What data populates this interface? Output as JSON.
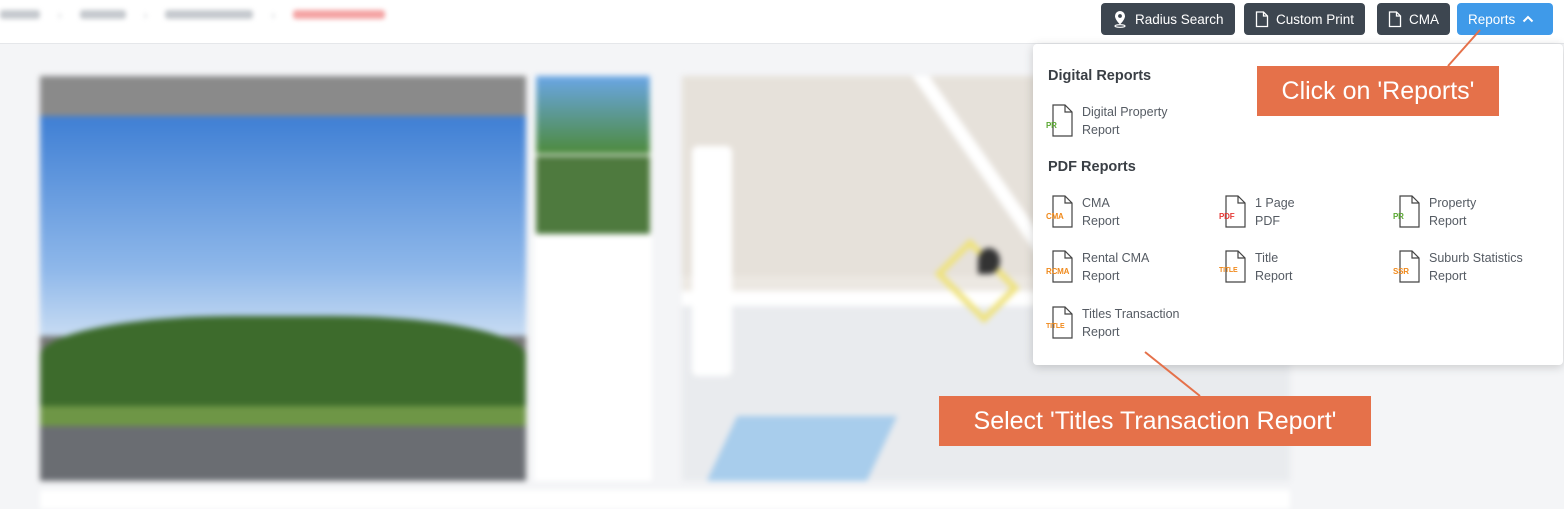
{
  "breadcrumbs": [
    "",
    "",
    "",
    ""
  ],
  "toolbar": {
    "radius_search": "Radius Search",
    "custom_print": "Custom Print",
    "cma": "CMA",
    "reports": "Reports"
  },
  "dropdown": {
    "digital_heading": "Digital Reports",
    "pdf_heading": "PDF Reports",
    "digital_items": [
      {
        "tag": "PR",
        "line1": "Digital Property",
        "line2": "Report",
        "color": "#5aa832"
      }
    ],
    "pdf_items": [
      {
        "tag": "CMA",
        "line1": "CMA",
        "line2": "Report",
        "color": "#f08a1c"
      },
      {
        "tag": "PDF",
        "line1": "1 Page",
        "line2": "PDF",
        "color": "#e53935"
      },
      {
        "tag": "PR",
        "line1": "Property",
        "line2": "Report",
        "color": "#5aa832"
      },
      {
        "tag": "RCMA",
        "line1": "Rental CMA",
        "line2": "Report",
        "color": "#f08a1c"
      },
      {
        "tag": "TITLE",
        "line1": "Title",
        "line2": "Report",
        "color": "#f08a1c"
      },
      {
        "tag": "SSR",
        "line1": "Suburb Statistics",
        "line2": "Report",
        "color": "#f08a1c"
      },
      {
        "tag": "TITLE",
        "line1": "Titles Transaction",
        "line2": "Report",
        "color": "#f08a1c"
      }
    ]
  },
  "callouts": {
    "click_reports": "Click on 'Reports'",
    "select_titles": "Select 'Titles Transaction Report'"
  },
  "colors": {
    "dark_button": "#3d4650",
    "accent_blue": "#3f9ae9",
    "callout": "#e5714a"
  },
  "icons": [
    "location-pin-icon",
    "document-icon",
    "chevron-up-icon",
    "file-icon"
  ]
}
